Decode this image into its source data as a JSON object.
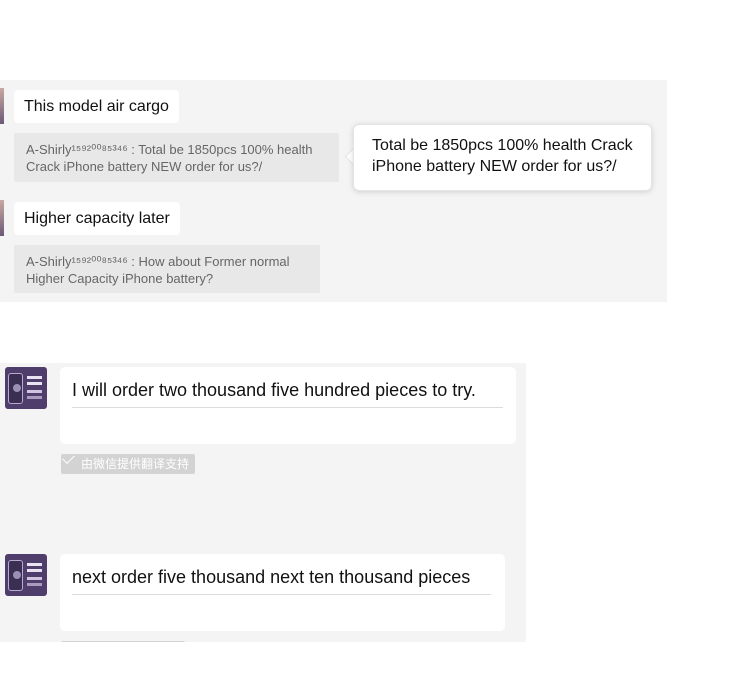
{
  "top_chat": {
    "messages": [
      {
        "text": "This model air cargo",
        "quote": "A-Shirly¹⁵⁹²⁰⁰⁸⁵³⁴⁶ : Total be 1850pcs 100% health Crack iPhone battery NEW order for us?/"
      },
      {
        "text": "Higher capacity later",
        "quote": "A-Shirly¹⁵⁹²⁰⁰⁸⁵³⁴⁶ : How about Former normal Higher Capacity iPhone battery?"
      }
    ],
    "translation_popup": "Total be 1850pcs 100% health Crack iPhone battery NEW order for us?/"
  },
  "bottom_chat": {
    "messages": [
      {
        "text": "I will order two thousand five hundred pieces to try."
      },
      {
        "text": "next order five thousand next ten thousand pieces"
      }
    ],
    "translate_badge": "由微信提供翻译支持"
  }
}
